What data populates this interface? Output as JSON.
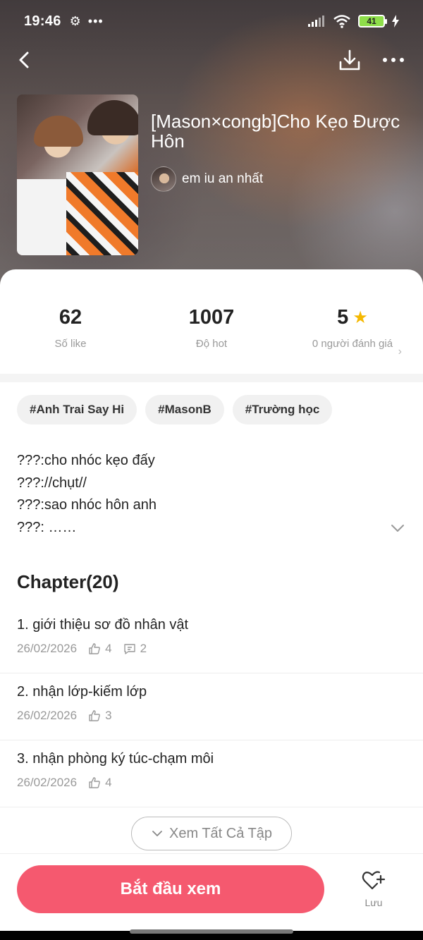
{
  "status_bar": {
    "time": "19:46",
    "battery": "41"
  },
  "story": {
    "title": "[Mason×congb]Cho Kẹo Được Hôn",
    "author": "em iu an nhất"
  },
  "stats": {
    "likes": {
      "value": "62",
      "label": "Số like"
    },
    "hot": {
      "value": "1007",
      "label": "Độ hot"
    },
    "rating": {
      "value": "5",
      "label": "0 người đánh giá"
    }
  },
  "tags": [
    "#Anh Trai Say Hi",
    "#MasonB",
    "#Trường học"
  ],
  "description": [
    "???:cho nhóc kẹo đấy",
    "???://chụt//",
    "???:sao nhóc hôn anh",
    "???: ……"
  ],
  "chapters_heading": "Chapter(20)",
  "chapters": [
    {
      "title": "1. giới thiệu sơ đồ nhân vật",
      "date": "26/02/2026",
      "likes": "4",
      "comments": "2"
    },
    {
      "title": "2. nhận lớp-kiếm lớp",
      "date": "26/02/2026",
      "likes": "3"
    },
    {
      "title": "3. nhận phòng ký túc-chạm môi",
      "date": "26/02/2026",
      "likes": "4"
    }
  ],
  "see_all_label": "Xem Tất Cả Tập",
  "start_button": "Bắt đầu xem",
  "save_label": "Lưu",
  "colors": {
    "accent": "#f5596f",
    "star": "#f5b800",
    "battery": "#8ede4a"
  },
  "icons": [
    "back-icon",
    "download-icon",
    "more-icon",
    "gear-icon",
    "star-icon",
    "chevron-down-icon",
    "thumb-up-icon",
    "comment-icon",
    "heart-plus-icon"
  ]
}
